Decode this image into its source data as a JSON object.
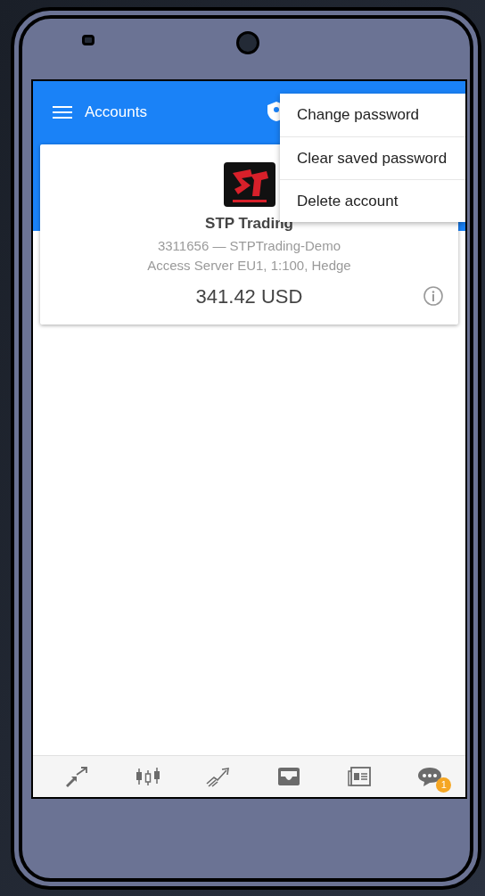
{
  "toolbar": {
    "title": "Accounts"
  },
  "menu": [
    {
      "label": "Change password"
    },
    {
      "label": "Clear saved password"
    },
    {
      "label": "Delete account"
    }
  ],
  "account": {
    "name": "STP Trading",
    "login": "3311656 — STPTrading-Demo",
    "server": "Access Server EU1, 1:100, Hedge",
    "balance": "341.42 USD"
  },
  "bottom_nav": [
    {
      "kind": "trade"
    },
    {
      "kind": "quotes"
    },
    {
      "kind": "chart"
    },
    {
      "kind": "inbox"
    },
    {
      "kind": "news"
    },
    {
      "kind": "chat",
      "badge": "1"
    }
  ]
}
